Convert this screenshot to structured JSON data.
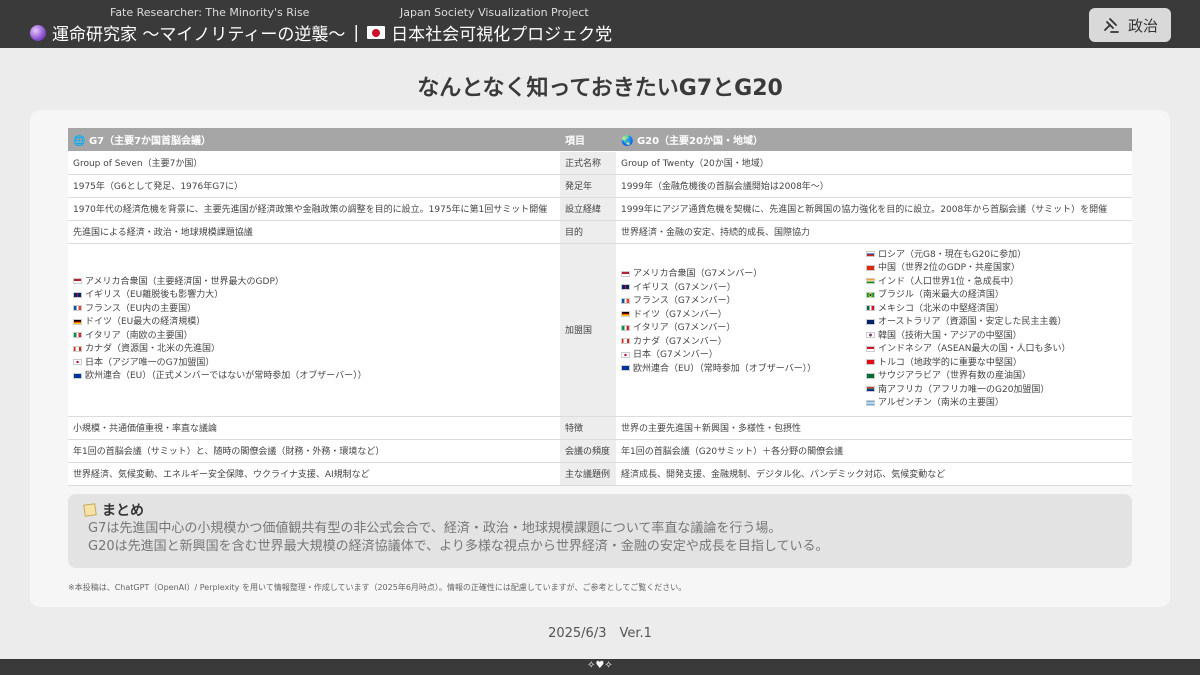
{
  "header": {
    "sub_left": "Fate Researcher: The Minority's Rise",
    "sub_right": "Japan Society Visualization Project",
    "title_left": "運命研究家 〜マイノリティーの逆襲〜",
    "separator": "|",
    "title_right": "日本社会可視化プロジェク党",
    "politics_button": "政治"
  },
  "page_title": "なんとなく知っておきたいG7とG20",
  "table": {
    "head_g7": "G7（主要7か国首脳会議）",
    "head_item": "項目",
    "head_g20": "G20（主要20か国・地域）",
    "rows": [
      {
        "g7": "Group of Seven（主要7か国）",
        "item": "正式名称",
        "g20": "Group of Twenty（20か国・地域）"
      },
      {
        "g7": "1975年（G6として発足、1976年G7に）",
        "item": "発足年",
        "g20": "1999年（金融危機後の首脳会議開始は2008年〜）"
      },
      {
        "g7": "1970年代の経済危機を背景に、主要先進国が経済政策や金融政策の調整を目的に設立。1975年に第1回サミット開催",
        "item": "設立経緯",
        "g20": "1999年にアジア通貨危機を契機に、先進国と新興国の協力強化を目的に設立。2008年から首脳会議（サミット）を開催"
      },
      {
        "g7": "先進国による経済・政治・地球規模課題協議",
        "item": "目的",
        "g20": "世界経済・金融の安定、持続的成長、国際協力"
      }
    ],
    "members_item": "加盟国",
    "g7_members": [
      "アメリカ合衆国（主要経済国・世界最大のGDP）",
      "イギリス（EU離脱後も影響力大）",
      "フランス（EU内の主要国）",
      "ドイツ（EU最大の経済規模）",
      "イタリア（南欧の主要国）",
      "カナダ（資源国・北米の先進国）",
      "日本（アジア唯一のG7加盟国）",
      "欧州連合（EU）（正式メンバーではないが常時参加（オブザーバー））"
    ],
    "g20_members_a": [
      "アメリカ合衆国（G7メンバー）",
      "イギリス（G7メンバー）",
      "フランス（G7メンバー）",
      "ドイツ（G7メンバー）",
      "イタリア（G7メンバー）",
      "カナダ（G7メンバー）",
      "日本（G7メンバー）",
      "欧州連合（EU）（常時参加（オブザーバー））"
    ],
    "g20_members_b": [
      "ロシア（元G8・現在もG20に参加）",
      "中国（世界2位のGDP・共産国家）",
      "インド（人口世界1位・急成長中）",
      "ブラジル（南米最大の経済国）",
      "メキシコ（北米の中堅経済国）",
      "オーストラリア（資源国・安定した民主主義）",
      "韓国（技術大国・アジアの中堅国）",
      "インドネシア（ASEAN最大の国・人口も多い）",
      "トルコ（地政学的に重要な中堅国）",
      "サウジアラビア（世界有数の産油国）",
      "南アフリカ（アフリカ唯一のG20加盟国）",
      "アルゼンチン（南米の主要国）"
    ],
    "rows_after": [
      {
        "g7": "小規模・共通価値重視・率直な議論",
        "item": "特徴",
        "g20": "世界の主要先進国＋新興国・多様性・包摂性"
      },
      {
        "g7": "年1回の首脳会議（サミット）と、随時の閣僚会議（財務・外務・環境など）",
        "item": "会議の頻度",
        "g20": "年1回の首脳会議（G20サミット）＋各分野の閣僚会議"
      },
      {
        "g7": "世界経済、気候変動、エネルギー安全保障、ウクライナ支援、AI規制など",
        "item": "主な議題例",
        "g20": "経済成長、開発支援、金融規制、デジタル化、パンデミック対応、気候変動など"
      }
    ]
  },
  "summary": {
    "title": "まとめ",
    "line1": "G7は先進国中心の小規模かつ価値観共有型の非公式会合で、経済・政治・地球規模課題について率直な議論を行う場。",
    "line2": "G20は先進国と新興国を含む世界最大規模の経済協議体で、より多様な視点から世界経済・金融の安定や成長を目指している。"
  },
  "note": "※本投稿は、ChatGPT（OpenAI）/ Perplexity を用いて情報整理・作成しています（2025年6月時点）。情報の正確性には配慮していますが、ご参考としてご覧ください。",
  "date_version": "2025/6/3　Ver.1",
  "colors": {
    "header_bg": "#3a3a3a",
    "table_head": "#a6a6a6",
    "card_bg": "#f6f6f6",
    "summary_bg": "#e3e3e3"
  }
}
